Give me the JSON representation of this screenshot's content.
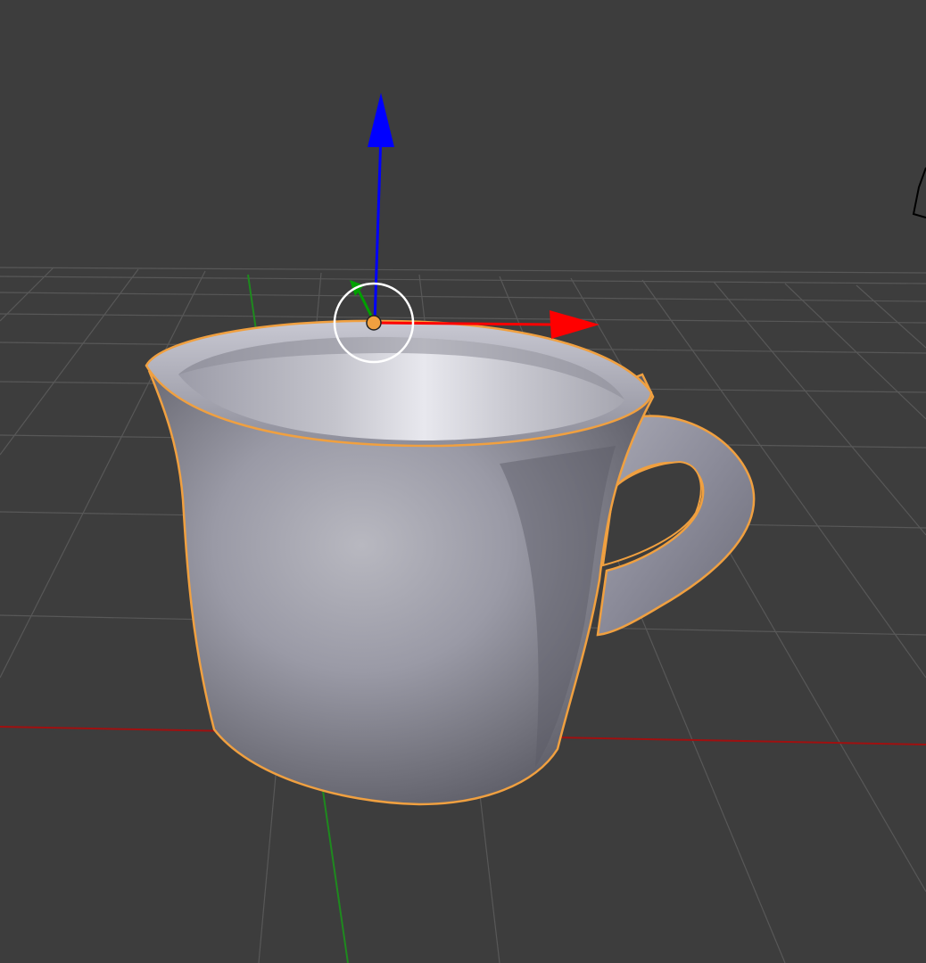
{
  "viewport": {
    "background_color": "#3d3d3d",
    "grid_color": "#5a5a5a",
    "axis_x_color": "#b40000",
    "axis_y_color": "#1e8c1e",
    "selection_outline_color": "#f0a040",
    "object_color": "#a6a6b4"
  },
  "scene": {
    "selected_object": "cup-mesh"
  },
  "gizmo": {
    "mode": "translate",
    "z_arrow_color": "#0000ff",
    "x_arrow_color": "#ff0000",
    "y_arrow_color": "#00a000",
    "pivot_color": "#f0a040"
  },
  "icons": {
    "camera": "camera-icon"
  }
}
